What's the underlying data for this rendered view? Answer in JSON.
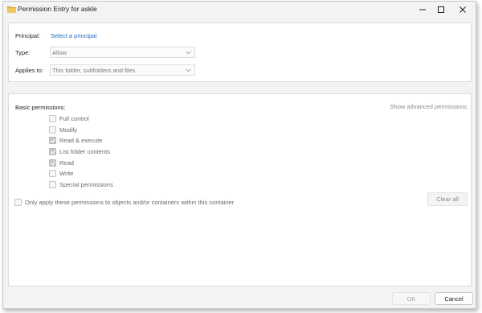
{
  "window": {
    "title": "Permission Entry for askle"
  },
  "principal": {
    "label": "Principal:",
    "link": "Select a principal"
  },
  "type": {
    "label": "Type:",
    "value": "Allow"
  },
  "applies_to": {
    "label": "Applies to:",
    "value": "This folder, subfolders and files"
  },
  "basic": {
    "title": "Basic permissions:",
    "advanced_link": "Show advanced permissions",
    "items": [
      {
        "label": "Full control",
        "checked": false
      },
      {
        "label": "Modify",
        "checked": false
      },
      {
        "label": "Read & execute",
        "checked": true
      },
      {
        "label": "List folder contents",
        "checked": true
      },
      {
        "label": "Read",
        "checked": true
      },
      {
        "label": "Write",
        "checked": false
      },
      {
        "label": "Special permissions",
        "checked": false
      }
    ]
  },
  "only_apply": {
    "label": "Only apply these permissions to objects and/or containers within this container",
    "checked": false
  },
  "buttons": {
    "clear_all": "Clear all",
    "ok": "OK",
    "cancel": "Cancel"
  },
  "colors": {
    "link": "#1a6cbf",
    "folder_icon": "#e8b64a"
  }
}
